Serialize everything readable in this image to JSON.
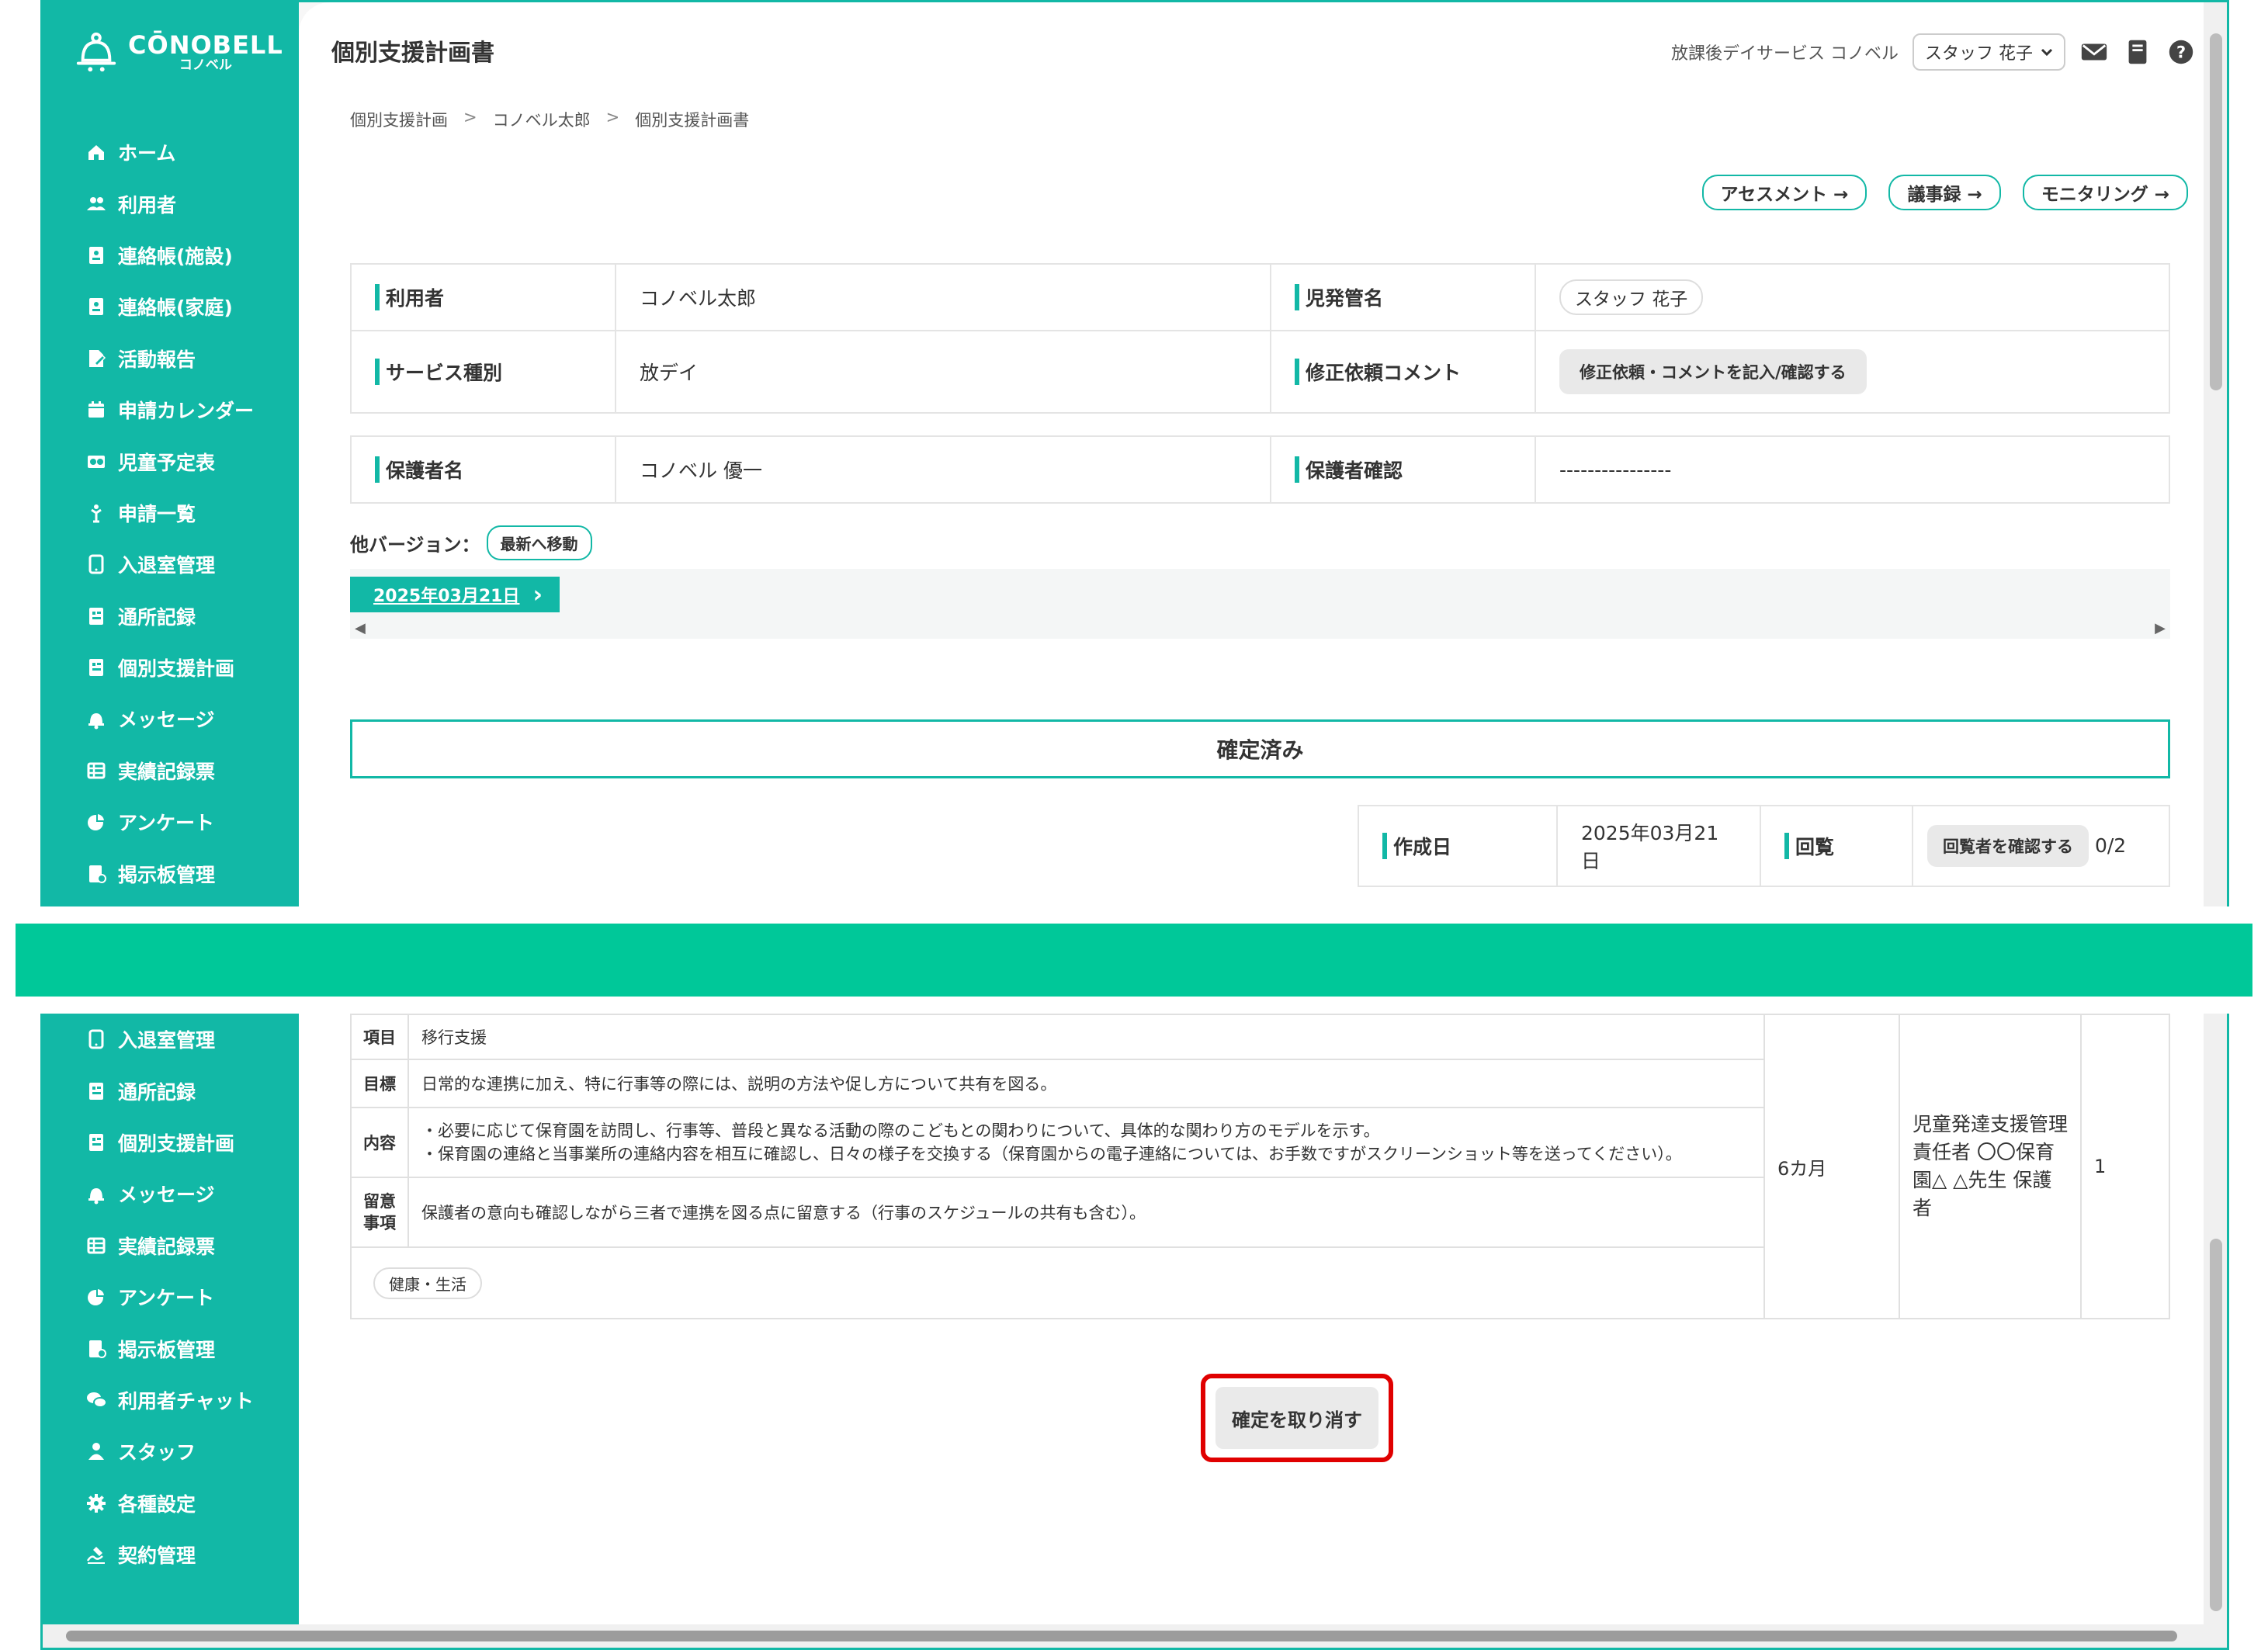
{
  "app": {
    "logo_text": "CŌNOBELL",
    "logo_sub": "コノベル"
  },
  "sidebar_top": [
    {
      "label": "ホーム",
      "icon": "home-icon"
    },
    {
      "label": "利用者",
      "icon": "users-icon"
    },
    {
      "label": "連絡帳(施設)",
      "icon": "contact-book-icon"
    },
    {
      "label": "連絡帳(家庭)",
      "icon": "contact-book-icon"
    },
    {
      "label": "活動報告",
      "icon": "edit-doc-icon"
    },
    {
      "label": "申請カレンダー",
      "icon": "calendar-icon"
    },
    {
      "label": "児童予定表",
      "icon": "schedule-icon"
    },
    {
      "label": "申請一覧",
      "icon": "pick-icon"
    },
    {
      "label": "入退室管理",
      "icon": "tablet-icon"
    },
    {
      "label": "通所記録",
      "icon": "record-icon"
    },
    {
      "label": "個別支援計画",
      "icon": "record-icon"
    },
    {
      "label": "メッセージ",
      "icon": "bell-icon"
    },
    {
      "label": "実績記録票",
      "icon": "table-icon"
    },
    {
      "label": "アンケート",
      "icon": "pie-icon"
    },
    {
      "label": "掲示板管理",
      "icon": "board-icon"
    }
  ],
  "sidebar_bottom": [
    {
      "label": "入退室管理",
      "icon": "tablet-icon"
    },
    {
      "label": "通所記録",
      "icon": "record-icon"
    },
    {
      "label": "個別支援計画",
      "icon": "record-icon"
    },
    {
      "label": "メッセージ",
      "icon": "bell-icon"
    },
    {
      "label": "実績記録票",
      "icon": "table-icon"
    },
    {
      "label": "アンケート",
      "icon": "pie-icon"
    },
    {
      "label": "掲示板管理",
      "icon": "board-icon"
    },
    {
      "label": "利用者チャット",
      "icon": "chat-icon"
    },
    {
      "label": "スタッフ",
      "icon": "staff-icon"
    },
    {
      "label": "各種設定",
      "icon": "gear-icon"
    },
    {
      "label": "契約管理",
      "icon": "contract-icon"
    }
  ],
  "header": {
    "title": "個別支援計画書",
    "office": "放課後デイサービス コノベル",
    "staff": "スタッフ 花子"
  },
  "breadcrumb": [
    "個別支援計画",
    "コノベル太郎",
    "個別支援計画書"
  ],
  "quick_links": [
    "アセスメント →",
    "議事録 →",
    "モニタリング →"
  ],
  "info": {
    "user_label": "利用者",
    "user_value": "コノベル太郎",
    "manager_label": "児発管名",
    "manager_value": "スタッフ 花子",
    "service_label": "サービス種別",
    "service_value": "放デイ",
    "fix_label": "修正依頼コメント",
    "fix_button": "修正依頼・コメントを記入/確認する",
    "guardian_label": "保護者名",
    "guardian_value": "コノベル 優一",
    "guardian_confirm_label": "保護者確認",
    "guardian_confirm_value": "----------------"
  },
  "versions": {
    "label": "他バージョン：",
    "latest_button": "最新へ移動",
    "current": "2025年03月21日"
  },
  "status": "確定済み",
  "meta": {
    "created_label": "作成日",
    "created_value": "2025年03月21日",
    "circulation_label": "回覧",
    "circulation_button": "回覧者を確認する",
    "circulation_count": "0/2"
  },
  "goal": {
    "item_label": "項目",
    "item_value": "移行支援",
    "target_label": "目標",
    "target_value": "日常的な連携に加え、特に行事等の際には、説明の方法や促し方について共有を図る。",
    "content_label": "内容",
    "content_line1": "・必要に応じて保育園を訪問し、行事等、普段と異なる活動の際のこどもとの関わりについて、具体的な関わり方のモデルを示す。",
    "content_line2": "・保育園の連絡と当事業所の連絡内容を相互に確認し、日々の様子を交換する（保育園からの電子連絡については、お手数ですがスクリーンショット等を送ってください）。",
    "note_label": "留意\n事項",
    "note_value": "保護者の意向も確認しながら三者で連携を図る点に留意する（行事のスケジュールの共有も含む）。",
    "tag": "健康・生活",
    "period": "6カ月",
    "responsible": "児童発達支援管理責任者 〇〇保育園△ △先生 保護者",
    "priority": "1"
  },
  "cancel_button": "確定を取り消す",
  "colors": {
    "brand": "#12b8a6",
    "band": "#00c899",
    "highlight": "#e00000"
  }
}
